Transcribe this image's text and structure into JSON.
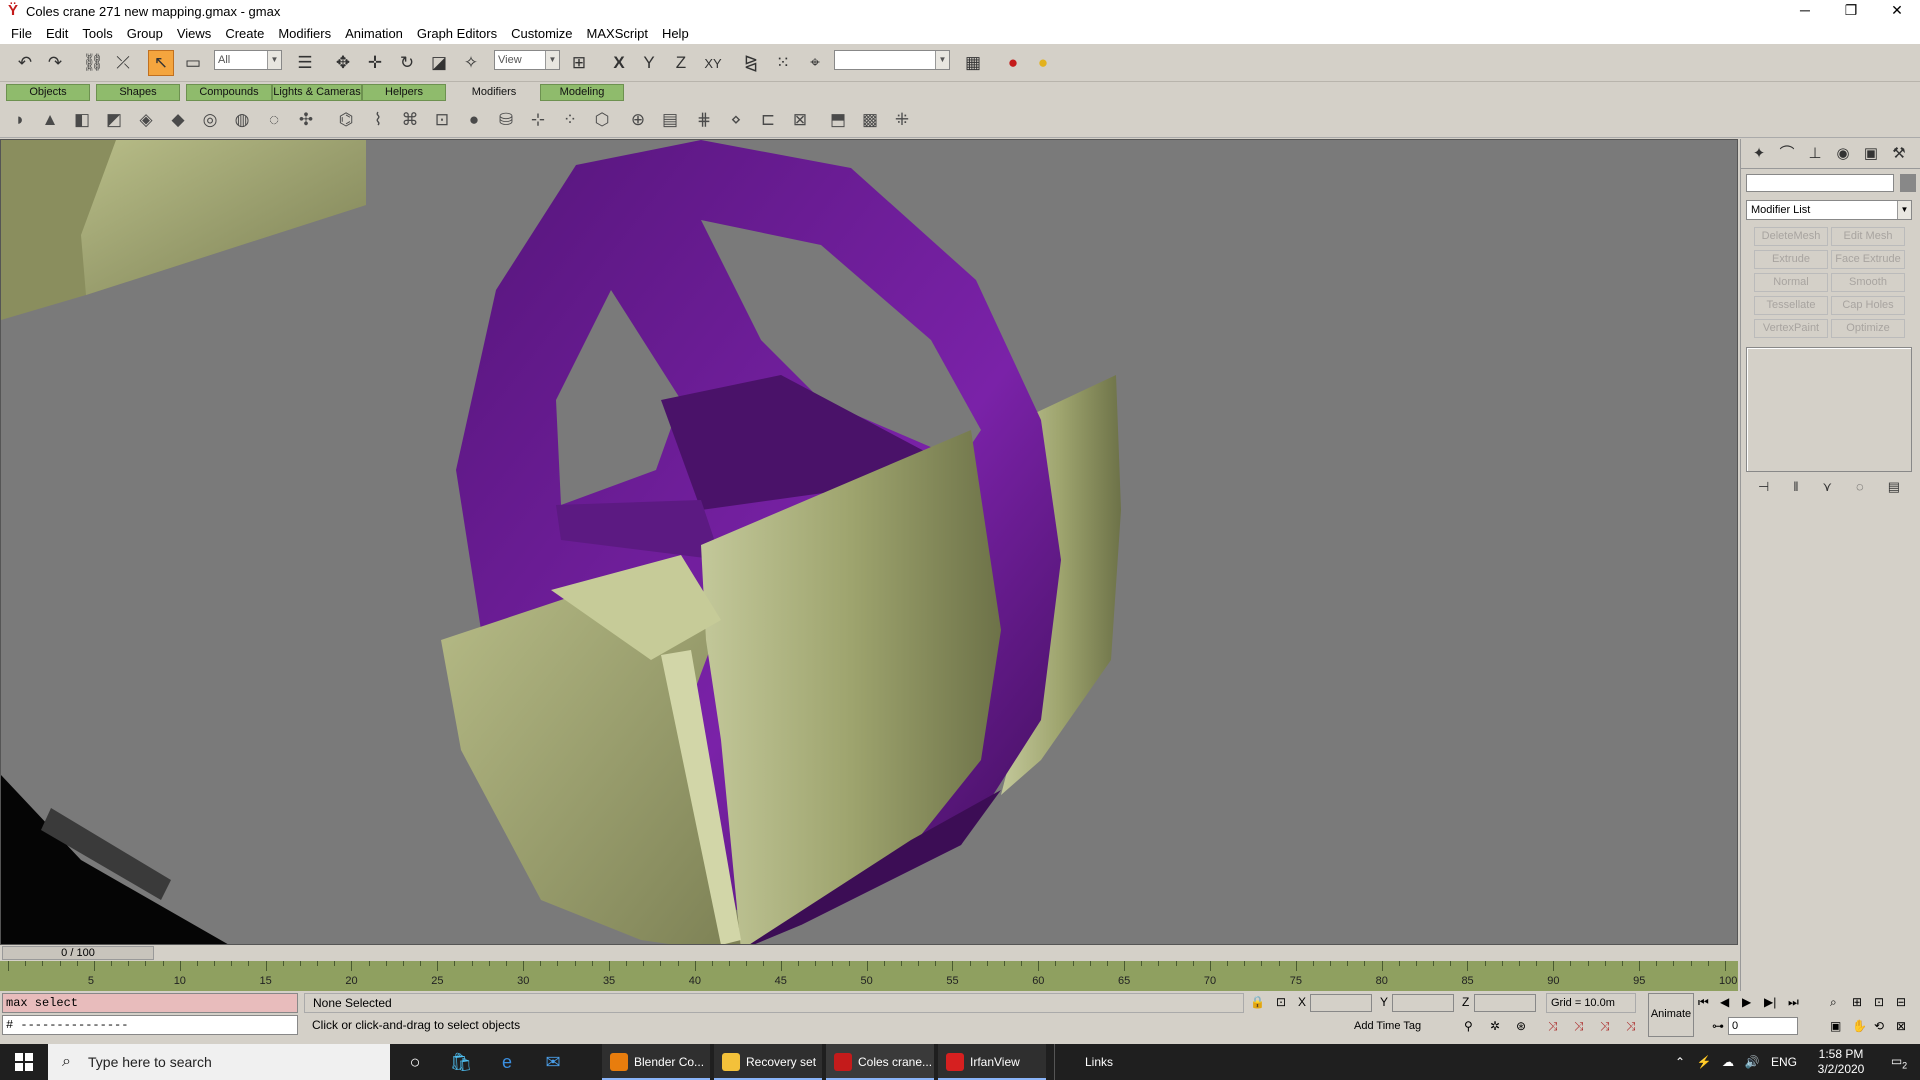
{
  "window": {
    "title": "Coles crane 271 new mapping.gmax - gmax",
    "minimize": "─",
    "maximize": "❐",
    "close": "✕"
  },
  "menu": [
    "File",
    "Edit",
    "Tools",
    "Group",
    "Views",
    "Create",
    "Modifiers",
    "Animation",
    "Graph Editors",
    "Customize",
    "MAXScript",
    "Help"
  ],
  "toolbar": {
    "selection_filter": "All",
    "ref_coord": "View",
    "named_selection": ""
  },
  "tabs": [
    "Objects",
    "Shapes",
    "Compounds",
    "Lights & Cameras",
    "Helpers",
    "Modifiers",
    "Modeling"
  ],
  "selected_tab": "Modifiers",
  "command_panel": {
    "modifier_list_label": "Modifier List",
    "buttons": [
      "DeleteMesh",
      "Edit Mesh",
      "Extrude",
      "Face Extrude",
      "Normal",
      "Smooth",
      "Tessellate",
      "Cap Holes",
      "VertexPaint",
      "Optimize"
    ]
  },
  "timeline": {
    "slider_label": "0 / 100",
    "ticks": [
      "5",
      "10",
      "15",
      "20",
      "25",
      "30",
      "35",
      "40",
      "45",
      "50",
      "55",
      "60",
      "65",
      "70",
      "75",
      "80",
      "85",
      "90",
      "95",
      "100"
    ]
  },
  "status": {
    "script_line1": "max select",
    "script_line2": "# ---------------",
    "prompt": "None Selected",
    "hint": "Click or click-and-drag to select objects",
    "x_label": "X",
    "y_label": "Y",
    "z_label": "Z",
    "grid": "Grid = 10.0m",
    "add_time_tag": "Add Time Tag",
    "animate": "Animate",
    "frame": "0"
  },
  "taskbar": {
    "search_placeholder": "Type here to search",
    "apps": [
      {
        "label": "Blender Co...",
        "color": "#e87d0d"
      },
      {
        "label": "Recovery set",
        "color": "#f3c13a"
      },
      {
        "label": "Coles crane...",
        "color": "#c41b1b"
      },
      {
        "label": "IrfanView",
        "color": "#d62020"
      }
    ],
    "links": "Links",
    "language": "ENG",
    "time": "1:58 PM",
    "date": "3/2/2020",
    "notifications": "2"
  },
  "colors": {
    "wheel_purple": "#6b1b8f",
    "mudguard_olive": "#a8ad78",
    "viewport_bg": "#7a7a7a",
    "timeline_green": "#8fa060"
  }
}
